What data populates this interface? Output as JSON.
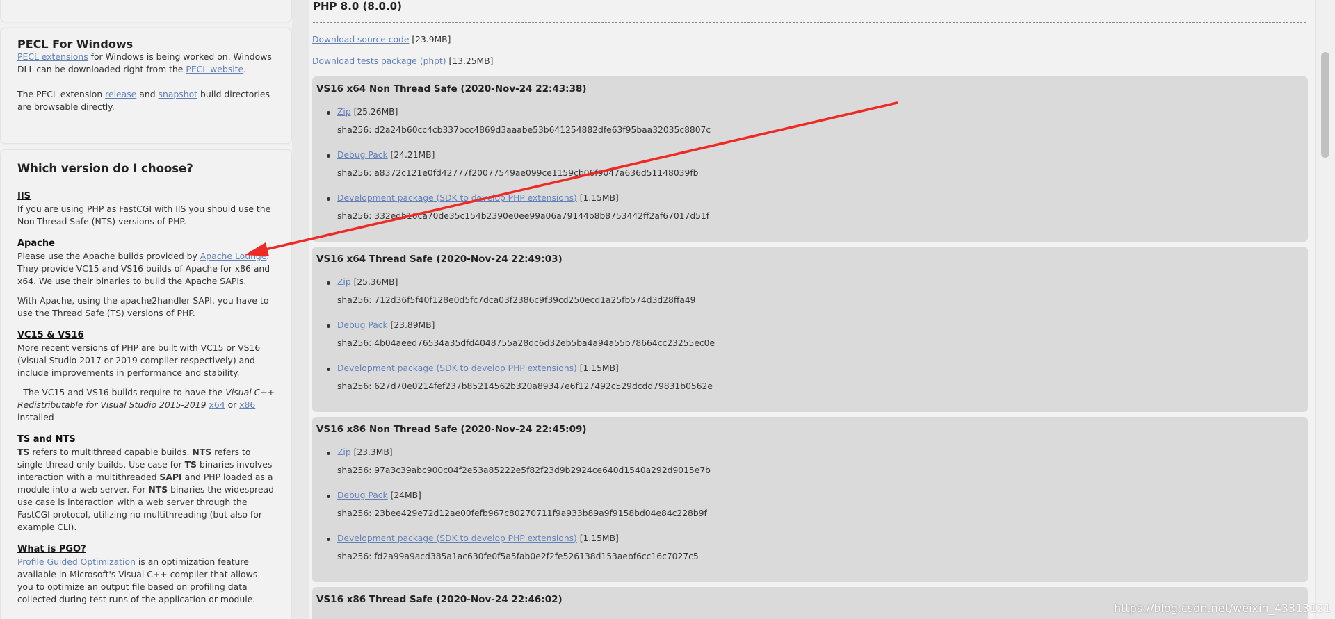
{
  "sidebar": {
    "pecl": {
      "title": "PECL For Windows",
      "p1_link1": "PECL extensions",
      "p1_text1": " for Windows is being worked on. Windows DLL can be downloaded right from the ",
      "p1_link2": "PECL website",
      "p1_text2": ".",
      "p2_text1": "The PECL extension ",
      "p2_link1": "release",
      "p2_text2": " and ",
      "p2_link2": "snapshot",
      "p2_text3": " build directories are browsable directly."
    },
    "choose": {
      "title": "Which version do I choose?",
      "iis_heading": "IIS",
      "iis_text": "If you are using PHP as FastCGI with IIS you should use the Non-Thread Safe (NTS) versions of PHP.",
      "apache_heading": "Apache",
      "apache_text1": "Please use the Apache builds provided by ",
      "apache_link": "Apache Lounge",
      "apache_text2": ". They provide VC15 and VS16 builds of Apache for x86 and x64. We use their binaries to build the Apache SAPIs.",
      "apache_p2": "With Apache, using the apache2handler SAPI, you have to use the Thread Safe (TS) versions of PHP.",
      "vc_heading": "VC15 & VS16",
      "vc_text": "More recent versions of PHP are built with VC15 or VS16 (Visual Studio 2017 or 2019 compiler respectively) and include improvements in performance and stability.",
      "vc_p2_text1": "- The VC15 and VS16 builds require to have the ",
      "vc_p2_italic": "Visual C++ Redistributable for Visual Studio 2015-2019",
      "vc_p2_link1": "x64",
      "vc_p2_or": " or ",
      "vc_p2_link2": "x86",
      "vc_p2_text2": " installed",
      "ts_heading": "TS and NTS",
      "ts_b1": "TS",
      "ts_t1": " refers to multithread capable builds. ",
      "ts_b2": "NTS",
      "ts_t2": " refers to single thread only builds. Use case for ",
      "ts_b3": "TS",
      "ts_t3": " binaries involves interaction with a multithreaded ",
      "ts_b4": "SAPI",
      "ts_t4": " and PHP loaded as a module into a web server. For ",
      "ts_b5": "NTS",
      "ts_t5": " binaries the widespread use case is interaction with a web server through the FastCGI protocol, utilizing no multithreading (but also for example CLI).",
      "pgo_heading": "What is PGO?",
      "pgo_link": "Profile Guided Optimization",
      "pgo_text": " is an optimization feature available in Microsoft's Visual C++ compiler that allows you to optimize an output file based on profiling data collected during test runs of the application or module."
    }
  },
  "main": {
    "release_title": "PHP 8.0 (8.0.0)",
    "source_link": "Download source code",
    "source_size": " [23.9MB]",
    "tests_link": "Download tests package (phpt)",
    "tests_size": " [13.25MB]",
    "sha_prefix": "sha256: ",
    "builds": [
      {
        "title": "VS16 x64 Non Thread Safe (2020-Nov-24 22:43:38)",
        "files": [
          {
            "name": "Zip",
            "size": " [25.26MB]",
            "sha": "d2a24b60cc4cb337bcc4869d3aaabe53b641254882dfe63f95baa32035c8807c"
          },
          {
            "name": "Debug Pack",
            "size": " [24.21MB]",
            "sha": "a8372c121e0fd42777f20077549ae099ce1159cb06f9047a636d51148039fb"
          },
          {
            "name": "Development package (SDK to develop PHP extensions)",
            "size": " [1.15MB]",
            "sha": "332edb16ca70de35c154b2390e0ee99a06a79144b8b8753442ff2af67017d51f"
          }
        ]
      },
      {
        "title": "VS16 x64 Thread Safe (2020-Nov-24 22:49:03)",
        "files": [
          {
            "name": "Zip",
            "size": " [25.36MB]",
            "sha": "712d36f5f40f128e0d5fc7dca03f2386c9f39cd250ecd1a25fb574d3d28ffa49"
          },
          {
            "name": "Debug Pack",
            "size": " [23.89MB]",
            "sha": "4b04aeed76534a35dfd4048755a28dc6d32eb5ba4a94a55b78664cc23255ec0e"
          },
          {
            "name": "Development package (SDK to develop PHP extensions)",
            "size": " [1.15MB]",
            "sha": "627d70e0214fef237b85214562b320a89347e6f127492c529dcdd79831b0562e"
          }
        ]
      },
      {
        "title": "VS16 x86 Non Thread Safe (2020-Nov-24 22:45:09)",
        "files": [
          {
            "name": "Zip",
            "size": " [23.3MB]",
            "sha": "97a3c39abc900c04f2e53a85222e5f82f23d9b2924ce640d1540a292d9015e7b"
          },
          {
            "name": "Debug Pack",
            "size": " [24MB]",
            "sha": "23bee429e72d12ae00fefb967c80270711f9a933b89a9f9158bd04e84c228b9f"
          },
          {
            "name": "Development package (SDK to develop PHP extensions)",
            "size": " [1.15MB]",
            "sha": "fd2a99a9acd385a1ac630fe0f5a5fab0e2f2fe526138d153aebf6cc16c7027c5"
          }
        ]
      },
      {
        "title": "VS16 x86 Thread Safe (2020-Nov-24 22:46:02)",
        "files": []
      }
    ]
  },
  "watermark": "https://blog.csdn.net/weixin_43313121",
  "colors": {
    "link": "#6181b8",
    "annotation_arrow": "#ee2a24",
    "build_bg": "#dadada"
  }
}
